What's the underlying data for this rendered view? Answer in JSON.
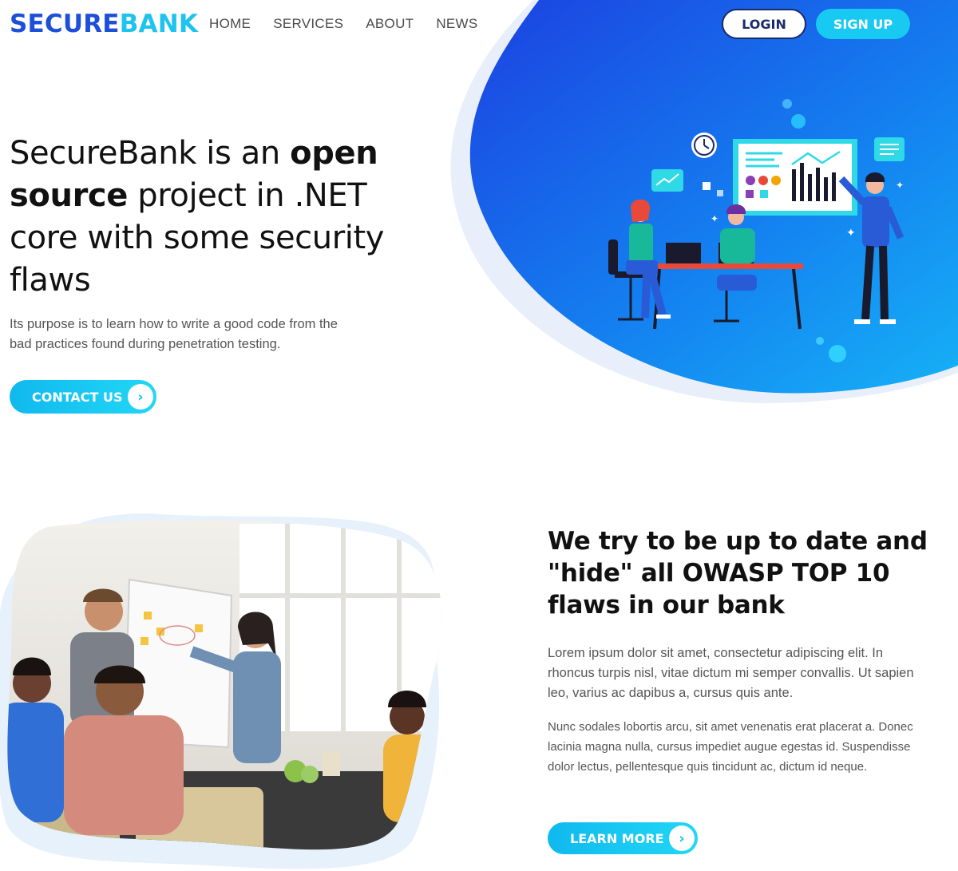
{
  "brand": {
    "logo_part1": "SECURE",
    "logo_part2": "BANK",
    "primary_color": "#1d4fd8",
    "accent_color": "#18c9f2"
  },
  "nav": {
    "links": [
      "HOME",
      "SERVICES",
      "ABOUT",
      "NEWS"
    ],
    "login_label": "LOGIN",
    "signup_label": "SIGN UP"
  },
  "hero": {
    "title_part1": "SecureBank is an ",
    "title_bold1": "open source",
    "title_part2": " project in .NET core with some security flaws",
    "subtitle": "Its purpose is to learn how to write a good code from the bad practices found during penetration testing.",
    "cta_label": "CONTACT US",
    "cta_icon": "chevron-right-icon"
  },
  "section2": {
    "title_part1": "We try to be up to date and \"hide\" all ",
    "title_bold": "OWASP TOP 10",
    "title_part2": " flaws in our bank",
    "paragraph1": "Lorem ipsum dolor sit amet, consectetur adipiscing elit. In rhoncus turpis nisl, vitae dictum mi semper convallis. Ut sapien leo, varius ac dapibus a, cursus quis ante.",
    "paragraph2": "Nunc sodales lobortis arcu, sit amet venenatis erat placerat a. Donec lacinia magna nulla, cursus impediet augue egestas id. Suspendisse dolor lectus, pellentesque quis tincidunt ac, dictum id neque.",
    "cta_label": "LEARN MORE",
    "cta_icon": "chevron-right-icon"
  }
}
